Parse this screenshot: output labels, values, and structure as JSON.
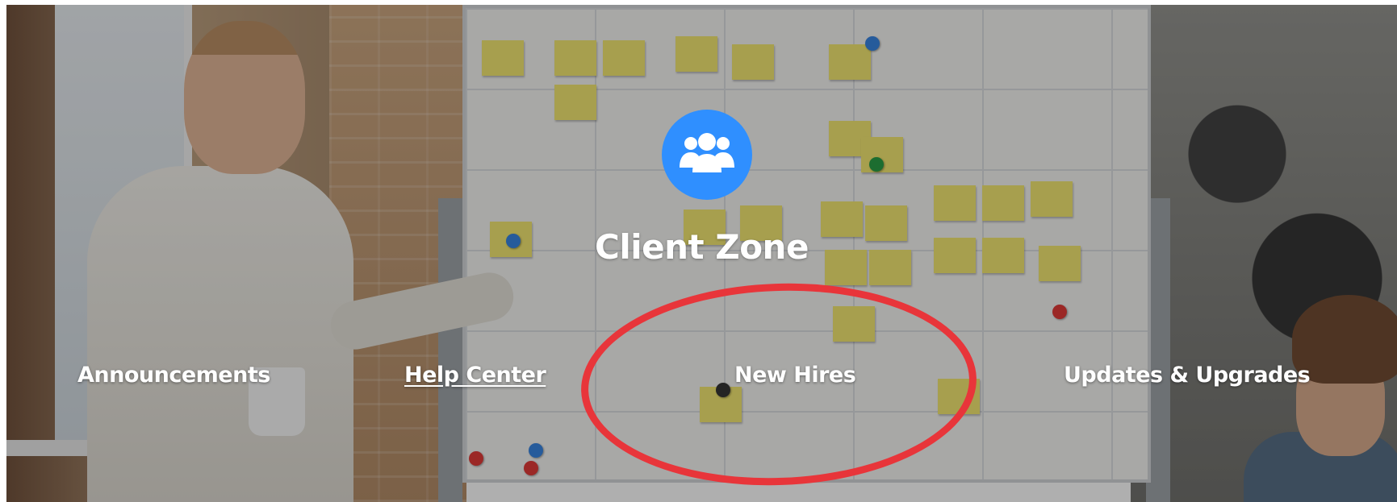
{
  "hero": {
    "title": "Client Zone",
    "icon": "users-group-icon",
    "icon_color": "#2f8fff"
  },
  "nav": {
    "announcements": "Announcements",
    "help_center": "Help Center",
    "new_hires": "New Hires",
    "updates_upgrades": "Updates & Upgrades"
  },
  "annotation": {
    "highlight_color": "#e8353a",
    "highlights": "New Hires"
  }
}
